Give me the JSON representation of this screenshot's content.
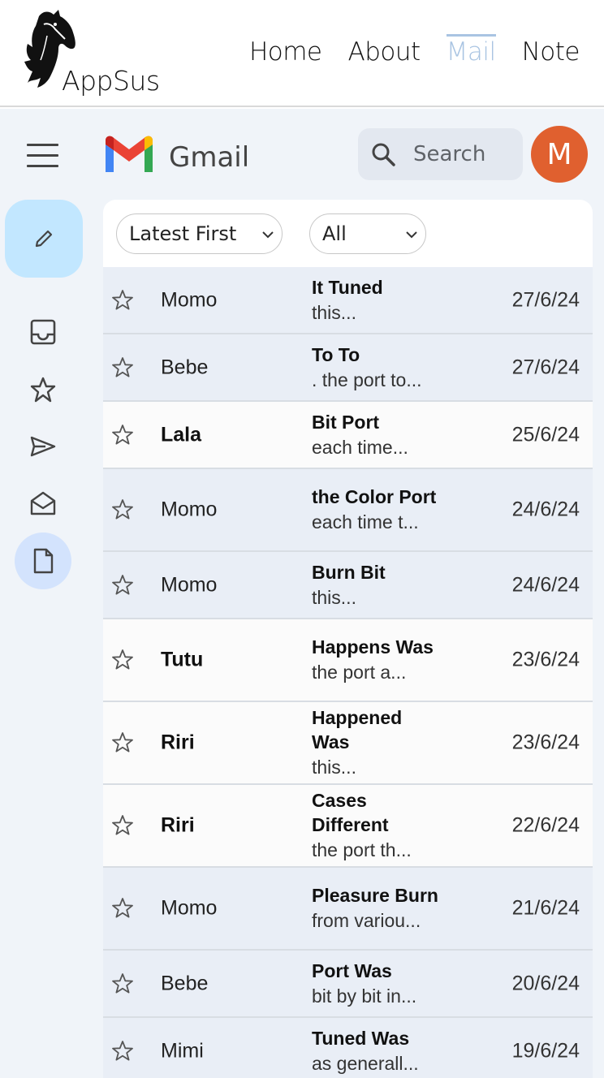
{
  "app": {
    "logo_text": "AppSus",
    "nav": [
      {
        "label": "Home"
      },
      {
        "label": "About"
      },
      {
        "label": "Mail"
      },
      {
        "label": "Note"
      }
    ]
  },
  "gmail": {
    "title": "Gmail",
    "search_placeholder": "Search",
    "avatar_letter": "M",
    "avatar_color": "#e0602f",
    "sidebar_icons": [
      "compose-icon",
      "inbox-icon",
      "starred-icon",
      "sent-icon",
      "all-mail-icon",
      "drafts-icon"
    ],
    "active_folder": "drafts-icon"
  },
  "filters": {
    "sort": "Latest First",
    "status": "All"
  },
  "emails": [
    {
      "from": "Momo",
      "subject": "It Tuned",
      "snippet": "this...",
      "date": "27/6/24",
      "read": true
    },
    {
      "from": "Bebe",
      "subject": "To To",
      "snippet": ". the port to...",
      "date": "27/6/24",
      "read": true
    },
    {
      "from": "Lala",
      "subject": "Bit Port",
      "snippet": "each time...",
      "date": "25/6/24",
      "read": false
    },
    {
      "from": "Momo",
      "subject": "the Color Port",
      "snippet": "each time t...",
      "date": "24/6/24",
      "read": true
    },
    {
      "from": "Momo",
      "subject": "Burn Bit",
      "snippet": "this...",
      "date": "24/6/24",
      "read": true
    },
    {
      "from": "Tutu",
      "subject": "Happens Was",
      "snippet": "the port a...",
      "date": "23/6/24",
      "read": false
    },
    {
      "from": "Riri",
      "subject": "Happened Was",
      "snippet": "this...",
      "date": "23/6/24",
      "read": false
    },
    {
      "from": "Riri",
      "subject": "Cases Different",
      "snippet": "the port th...",
      "date": "22/6/24",
      "read": false
    },
    {
      "from": "Momo",
      "subject": "Pleasure Burn",
      "snippet": "from variou...",
      "date": "21/6/24",
      "read": true
    },
    {
      "from": "Bebe",
      "subject": "Port Was",
      "snippet": "bit by bit in...",
      "date": "20/6/24",
      "read": true
    },
    {
      "from": "Mimi",
      "subject": "Tuned Was",
      "snippet": "as generall...",
      "date": "19/6/24",
      "read": true
    }
  ]
}
